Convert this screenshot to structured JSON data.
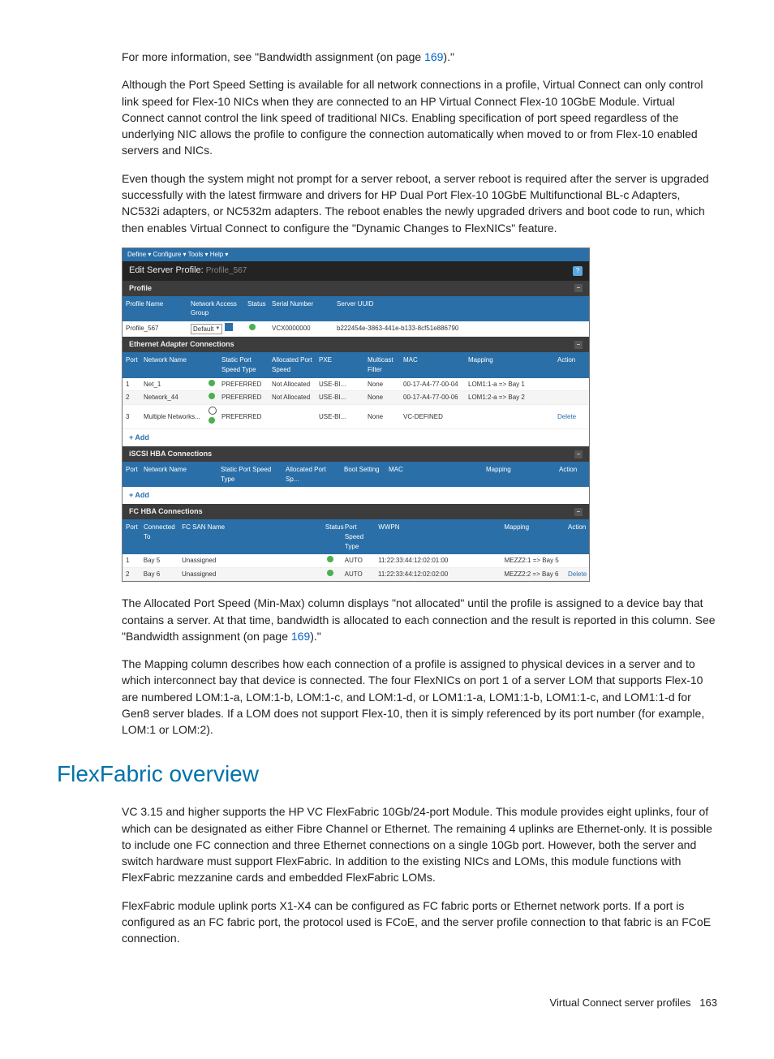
{
  "intro": {
    "p1_a": "For more information, see \"Bandwidth assignment (on page ",
    "p1_link": "169",
    "p1_b": ").\"",
    "p2": "Although the Port Speed Setting is available for all network connections in a profile, Virtual Connect can only control link speed for Flex-10 NICs when they are connected to an HP Virtual Connect Flex-10 10GbE Module. Virtual Connect cannot control the link speed of traditional NICs. Enabling specification of port speed regardless of the underlying NIC allows the profile to configure the connection automatically when moved to or from Flex-10 enabled servers and NICs.",
    "p3": "Even though the system might not prompt for a server reboot, a server reboot is required after the server is upgraded successfully with the latest firmware and drivers for HP Dual Port Flex-10 10GbE Multifunctional BL-c Adapters, NC532i adapters, or NC532m adapters. The reboot enables the newly upgraded drivers and boot code to run, which then enables Virtual Connect to configure the \"Dynamic Changes to FlexNICs\" feature."
  },
  "screenshot": {
    "menu": "Define ▾    Configure ▾    Tools ▾    Help ▾",
    "title_label": "Edit Server Profile:",
    "title_value": "Profile_567",
    "profile_section": "Profile",
    "profile_headers": {
      "name": "Profile Name",
      "nag": "Network Access Group",
      "status": "Status",
      "serial": "Serial Number",
      "uuid": "Server UUID"
    },
    "profile_row": {
      "name": "Profile_567",
      "nag": "Default",
      "serial": "VCX0000000",
      "uuid": "b222454e-3863-441e-b133-8cf51e886790"
    },
    "eth_section": "Ethernet Adapter Connections",
    "eth_headers": {
      "port": "Port",
      "net": "Network Name",
      "spd": "Static Port Speed Type",
      "alloc": "Allocated Port Speed",
      "pxe": "PXE",
      "mcf": "Multicast Filter",
      "mac": "MAC",
      "map": "Mapping",
      "act": "Action"
    },
    "eth_rows": [
      {
        "port": "1",
        "net": "Net_1",
        "spd": "PREFERRED",
        "alloc": "Not Allocated",
        "pxe": "USE-BI...",
        "mcf": "None",
        "mac": "00-17-A4-77-00-04",
        "map": "LOM1:1-a => Bay 1",
        "act": ""
      },
      {
        "port": "2",
        "net": "Network_44",
        "spd": "PREFERRED",
        "alloc": "Not Allocated",
        "pxe": "USE-BI...",
        "mcf": "None",
        "mac": "00-17-A4-77-00-06",
        "map": "LOM1:2-a => Bay 2",
        "act": ""
      },
      {
        "port": "3",
        "net": "Multiple Networks...",
        "spd": "PREFERRED",
        "alloc": "",
        "pxe": "USE-BI...",
        "mcf": "None",
        "mac": "VC-DEFINED",
        "map": "",
        "act": "Delete"
      }
    ],
    "add_label": "+ Add",
    "iscsi_section": "iSCSI HBA Connections",
    "iscsi_headers": {
      "port": "Port",
      "net": "Network Name",
      "spd": "Static Port Speed Type",
      "alloc": "Allocated Port Sp...",
      "boot": "Boot Setting",
      "mac": "MAC",
      "map": "Mapping",
      "act": "Action"
    },
    "fc_section": "FC HBA Connections",
    "fc_headers": {
      "port": "Port",
      "conn": "Connected To",
      "san": "FC SAN Name",
      "status": "Status",
      "spd": "Port Speed Type",
      "wwpn": "WWPN",
      "map": "Mapping",
      "act": "Action"
    },
    "fc_rows": [
      {
        "port": "1",
        "conn": "Bay 5",
        "san": "Unassigned",
        "spd": "AUTO",
        "wwpn": "11:22:33:44:12:02:01:00",
        "map": "MEZZ2:1 => Bay 5",
        "act": ""
      },
      {
        "port": "2",
        "conn": "Bay 6",
        "san": "Unassigned",
        "spd": "AUTO",
        "wwpn": "11:22:33:44:12:02:02:00",
        "map": "MEZZ2:2 => Bay 6",
        "act": "Delete"
      }
    ]
  },
  "after": {
    "p4_a": "The Allocated Port Speed (Min-Max) column displays \"not allocated\" until the profile is assigned to a device bay that contains a server. At that time, bandwidth is allocated to each connection and the result is reported in this column. See \"Bandwidth assignment (on page ",
    "p4_link": "169",
    "p4_b": ").\"",
    "p5": "The Mapping column describes how each connection of a profile is assigned to physical devices in a server and to which interconnect bay that device is connected. The four FlexNICs on port 1 of a server LOM that supports Flex-10 are numbered LOM:1-a, LOM:1-b, LOM:1-c, and LOM:1-d, or LOM1:1-a, LOM1:1-b, LOM1:1-c, and LOM1:1-d for Gen8 server blades. If a LOM does not support Flex-10, then it is simply referenced by its port number (for example, LOM:1 or LOM:2)."
  },
  "heading": "FlexFabric overview",
  "flex": {
    "p6": "VC 3.15 and higher supports the HP VC FlexFabric 10Gb/24-port Module. This module provides eight uplinks, four of which can be designated as either Fibre Channel or Ethernet. The remaining 4 uplinks are Ethernet-only. It is possible to include one FC connection and three Ethernet connections on a single 10Gb port. However, both the server and switch hardware must support FlexFabric. In addition to the existing NICs and LOMs, this module functions with FlexFabric mezzanine cards and embedded FlexFabric LOMs.",
    "p7": "FlexFabric module uplink ports X1-X4 can be configured as FC fabric ports or Ethernet network ports. If a port is configured as an FC fabric port, the protocol used is FCoE, and the server profile connection to that fabric is an FCoE connection."
  },
  "footer": {
    "text": "Virtual Connect server profiles",
    "page": "163"
  }
}
